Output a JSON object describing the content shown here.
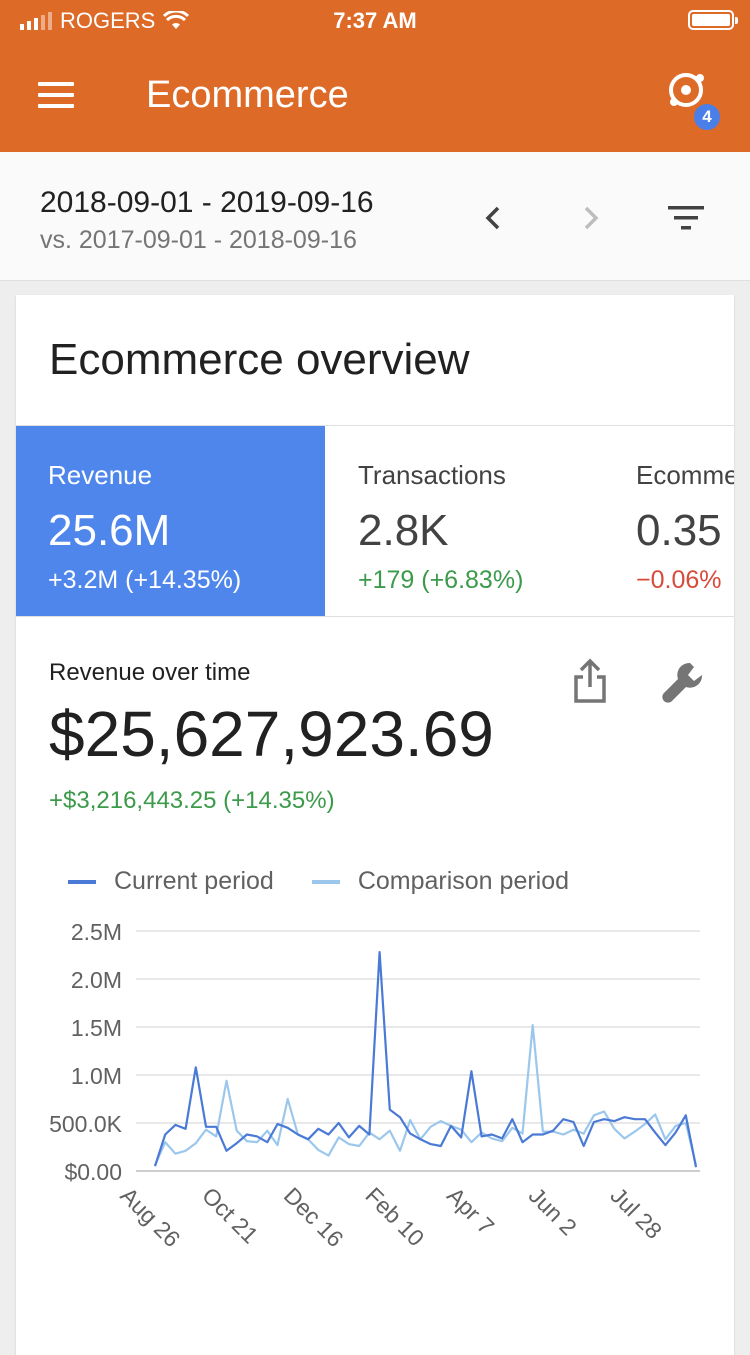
{
  "status_bar": {
    "carrier": "ROGERS",
    "time": "7:37 AM"
  },
  "app_bar": {
    "title": "Ecommerce",
    "badge_count": "4"
  },
  "date_range": {
    "current": "2018-09-01 - 2019-09-16",
    "comparison": "vs. 2017-09-01 - 2018-09-16"
  },
  "card": {
    "title": "Ecommerce overview"
  },
  "metrics": [
    {
      "label": "Revenue",
      "value": "25.6M",
      "change": "+3.2M (+14.35%)"
    },
    {
      "label": "Transactions",
      "value": "2.8K",
      "change": "+179 (+6.83%)"
    },
    {
      "label": "Ecomme",
      "value": "0.35",
      "change": "−0.06%"
    }
  ],
  "chart_section": {
    "label": "Revenue over time",
    "value": "$25,627,923.69",
    "change": "+$3,216,443.25 (+14.35%)"
  },
  "colors": {
    "accent": "#de6a28",
    "active_metric": "#4e86ec",
    "current_series": "#4a7ad6",
    "comparison_series": "#9cc7ec",
    "positive": "#3c9a4b",
    "negative": "#d84a3a"
  },
  "chart_data": {
    "type": "line",
    "y_ticks": [
      "2.5M",
      "2.0M",
      "1.5M",
      "1.0M",
      "500.0K",
      "$0.00"
    ],
    "ylim": [
      0,
      2500000
    ],
    "x_tick_labels": [
      "Aug 26",
      "Oct 21",
      "Dec 16",
      "Feb 10",
      "Apr 7",
      "Jun 2",
      "Jul 28"
    ],
    "x_tick_week_index": [
      0,
      8,
      16,
      24,
      32,
      40,
      48
    ],
    "grid": true,
    "legend": "top",
    "series": [
      {
        "name": "Current period",
        "values": [
          50000,
          380000,
          480000,
          440000,
          1080000,
          460000,
          460000,
          210000,
          290000,
          380000,
          360000,
          300000,
          490000,
          450000,
          380000,
          330000,
          440000,
          380000,
          500000,
          350000,
          470000,
          380000,
          2280000,
          640000,
          560000,
          390000,
          330000,
          280000,
          260000,
          470000,
          350000,
          1040000,
          360000,
          380000,
          340000,
          540000,
          300000,
          380000,
          380000,
          420000,
          540000,
          510000,
          260000,
          510000,
          540000,
          520000,
          560000,
          540000,
          540000,
          400000,
          270000,
          400000,
          580000,
          40000
        ]
      },
      {
        "name": "Comparison period",
        "values": [
          60000,
          300000,
          180000,
          210000,
          290000,
          430000,
          360000,
          940000,
          420000,
          310000,
          300000,
          420000,
          270000,
          750000,
          380000,
          330000,
          220000,
          160000,
          350000,
          280000,
          260000,
          400000,
          330000,
          420000,
          210000,
          530000,
          330000,
          460000,
          520000,
          470000,
          430000,
          300000,
          400000,
          340000,
          310000,
          450000,
          390000,
          1520000,
          410000,
          410000,
          380000,
          430000,
          390000,
          580000,
          620000,
          440000,
          340000,
          410000,
          490000,
          590000,
          330000,
          470000,
          500000,
          60000
        ]
      }
    ]
  }
}
